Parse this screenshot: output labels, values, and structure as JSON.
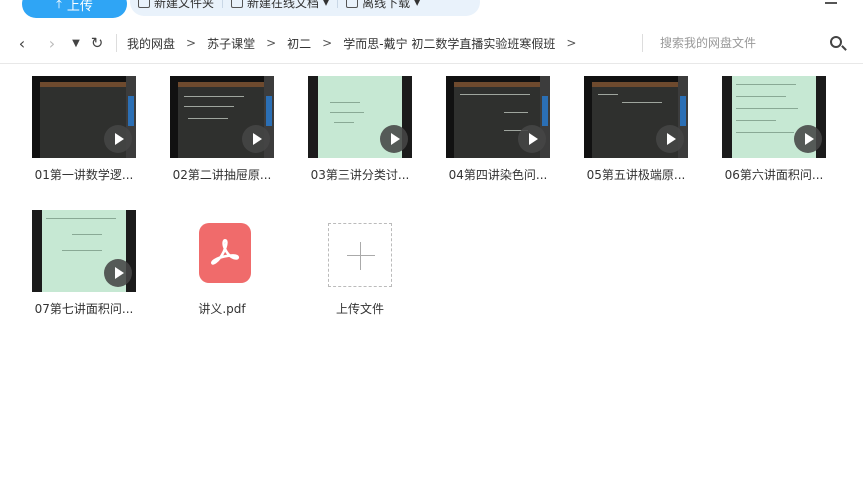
{
  "toolbar": {
    "upload_label": "上传",
    "new_folder_label": "新建文件夹",
    "new_online_doc_label": "新建在线文档",
    "offline_download_label": "离线下载"
  },
  "address_bar": {
    "breadcrumbs": [
      "我的网盘",
      "苏子课堂",
      "初二",
      "学而思-戴宁 初二数学直播实验班寒假班"
    ],
    "separator": ">",
    "search_placeholder": "搜索我的网盘文件"
  },
  "files": [
    {
      "name": "01第一讲数学逻...",
      "type": "video",
      "thumb": "dark"
    },
    {
      "name": "02第二讲抽屉原...",
      "type": "video",
      "thumb": "dark"
    },
    {
      "name": "03第三讲分类讨...",
      "type": "video",
      "thumb": "green"
    },
    {
      "name": "04第四讲染色问...",
      "type": "video",
      "thumb": "dark"
    },
    {
      "name": "05第五讲极端原...",
      "type": "video",
      "thumb": "dark"
    },
    {
      "name": "06第六讲面积问...",
      "type": "video",
      "thumb": "green"
    },
    {
      "name": "07第七讲面积问...",
      "type": "video",
      "thumb": "green"
    },
    {
      "name": "讲义.pdf",
      "type": "pdf"
    }
  ],
  "upload_tile_label": "上传文件",
  "colors": {
    "accent": "#2fa5f5",
    "pdf": "#f06b6b",
    "board": "#2f302e",
    "green_board": "#c6e8d3"
  }
}
